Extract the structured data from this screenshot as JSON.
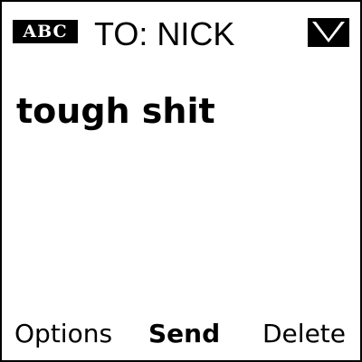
{
  "header": {
    "mode_badge": "ABC",
    "to_label": "TO:",
    "recipient": "NICK",
    "status_icon": "message-envelope-icon"
  },
  "message": {
    "text": "tough shit"
  },
  "softkeys": {
    "left": "Options",
    "center": "Send",
    "right": "Delete"
  }
}
